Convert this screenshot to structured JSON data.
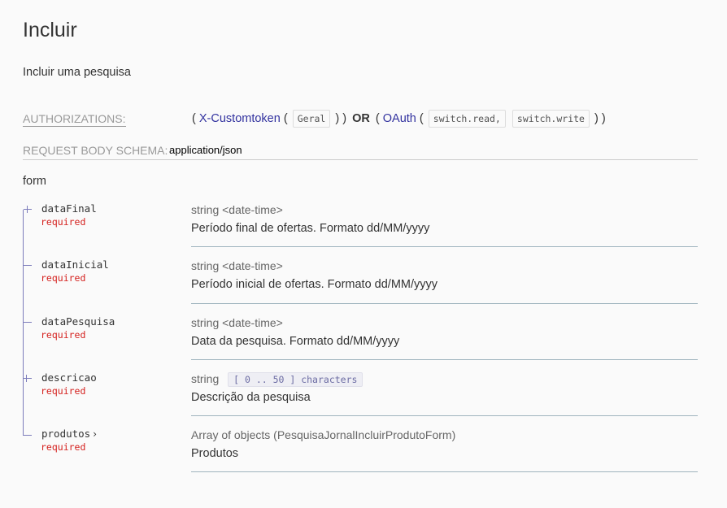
{
  "page": {
    "title": "Incluir",
    "description": "Incluir uma pesquisa"
  },
  "authorizations": {
    "label": "AUTHORIZATIONS:",
    "open1": "(",
    "scheme1": "X-Customtoken",
    "open1b": "(",
    "scope1": "Geral",
    "close1": ") )",
    "or": "OR",
    "open2": "(",
    "scheme2": "OAuth",
    "open2b": "(",
    "scope2a": "switch.read,",
    "scope2b": "switch.write",
    "close2": ") )"
  },
  "body_schema": {
    "label": "REQUEST BODY SCHEMA:",
    "content_type": "application/json"
  },
  "form_label": "form",
  "properties": [
    {
      "name": "dataFinal",
      "required": "required",
      "type": "string <date-time>",
      "description": "Período final de ofertas. Formato dd/MM/yyyy"
    },
    {
      "name": "dataInicial",
      "required": "required",
      "type": "string <date-time>",
      "description": "Período inicial de ofertas. Formato dd/MM/yyyy"
    },
    {
      "name": "dataPesquisa",
      "required": "required",
      "type": "string <date-time>",
      "description": "Data da pesquisa. Formato dd/MM/yyyy"
    },
    {
      "name": "descricao",
      "required": "required",
      "type": "string",
      "constraint": "[ 0 .. 50 ] characters",
      "description": "Descrição da pesquisa"
    },
    {
      "name": "produtos",
      "required": "required",
      "type": "Array of objects (PesquisaJornalIncluirProdutoForm)",
      "description": "Produtos",
      "expand_icon": "chevron-right-icon"
    }
  ],
  "colors": {
    "link": "#32329f",
    "required": "#d41f1c",
    "tree_line": "#7c7cbb",
    "row_divider": "#9fb4be"
  }
}
